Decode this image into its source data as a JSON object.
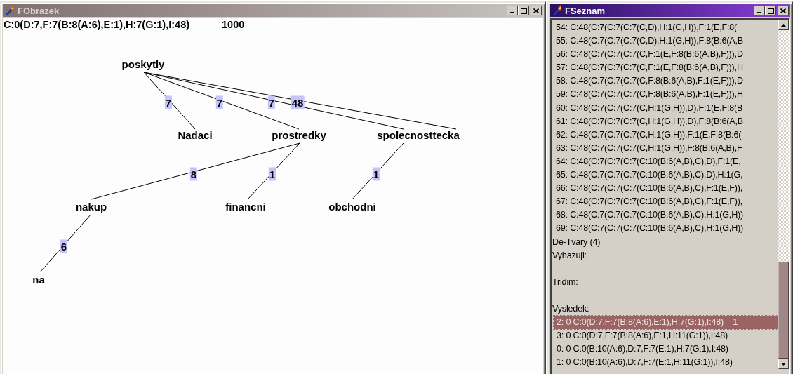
{
  "windows": [
    {
      "kind": "tree",
      "title": "FObrazek",
      "active": false,
      "summary": "C:0(D:7,F:7(B:8(A:6),E:1),H:7(G:1),I:48)",
      "score": "1000",
      "tree": {
        "word": "poskytly",
        "children": [
          {
            "word": "Nadaci",
            "weights": [
              "7"
            ]
          },
          {
            "word": "prostredky",
            "weights": [
              "7"
            ],
            "children": [
              {
                "word": "nakup",
                "weights": [
                  "8"
                ],
                "children": [
                  {
                    "word": "na",
                    "weights": [
                      "6"
                    ]
                  }
                ]
              },
              {
                "word": "financni",
                "weights": [
                  "1"
                ]
              }
            ]
          },
          {
            "word": "spolecnosttecka",
            "weights": [
              "7",
              "48"
            ],
            "children": [
              {
                "word": "obchodni",
                "weights": [
                  "1"
                ]
              }
            ]
          }
        ]
      }
    },
    {
      "kind": "list",
      "title": "FSeznam",
      "active": true,
      "lines": [
        {
          "kind": "entry",
          "text": "54: C:48(C:7(C:7(C:7(C,D),H:1(G,H)),F:1(E,F:8(",
          "selected": false
        },
        {
          "kind": "entry",
          "text": "55: C:48(C:7(C:7(C:7(C,D),H:1(G,H)),F:8(B:6(A,B",
          "selected": false
        },
        {
          "kind": "entry",
          "text": "56: C:48(C:7(C:7(C:7(C,F:1(E,F:8(B:6(A,B),F))),D",
          "selected": false
        },
        {
          "kind": "entry",
          "text": "57: C:48(C:7(C:7(C:7(C,F:1(E,F:8(B:6(A,B),F))),H",
          "selected": false
        },
        {
          "kind": "entry",
          "text": "58: C:48(C:7(C:7(C:7(C,F:8(B:6(A,B),F:1(E,F))),D",
          "selected": false
        },
        {
          "kind": "entry",
          "text": "59: C:48(C:7(C:7(C:7(C,F:8(B:6(A,B),F:1(E,F))),H",
          "selected": false
        },
        {
          "kind": "entry",
          "text": "60: C:48(C:7(C:7(C:7(C,H:1(G,H)),D),F:1(E,F:8(B",
          "selected": false
        },
        {
          "kind": "entry",
          "text": "61: C:48(C:7(C:7(C:7(C,H:1(G,H)),D),F:8(B:6(A,B",
          "selected": false
        },
        {
          "kind": "entry",
          "text": "62: C:48(C:7(C:7(C:7(C,H:1(G,H)),F:1(E,F:8(B:6(",
          "selected": false
        },
        {
          "kind": "entry",
          "text": "63: C:48(C:7(C:7(C:7(C,H:1(G,H)),F:8(B:6(A,B),F",
          "selected": false
        },
        {
          "kind": "entry",
          "text": "64: C:48(C:7(C:7(C:7(C:10(B:6(A,B),C),D),F:1(E,",
          "selected": false
        },
        {
          "kind": "entry",
          "text": "65: C:48(C:7(C:7(C:7(C:10(B:6(A,B),C),D),H:1(G,",
          "selected": false
        },
        {
          "kind": "entry",
          "text": "66: C:48(C:7(C:7(C:7(C:10(B:6(A,B),C),F:1(E,F)),",
          "selected": false
        },
        {
          "kind": "entry",
          "text": "67: C:48(C:7(C:7(C:7(C:10(B:6(A,B),C),F:1(E,F)),",
          "selected": false
        },
        {
          "kind": "entry",
          "text": "68: C:48(C:7(C:7(C:7(C:10(B:6(A,B),C),H:1(G,H))",
          "selected": false
        },
        {
          "kind": "entry",
          "text": "69: C:48(C:7(C:7(C:7(C:10(B:6(A,B),C),H:1(G,H))",
          "selected": false
        },
        {
          "kind": "heading",
          "text": "De-Tvary (4)"
        },
        {
          "kind": "heading",
          "text": "Vyhazuji:"
        },
        {
          "kind": "gap"
        },
        {
          "kind": "heading",
          "text": "Tridim:"
        },
        {
          "kind": "gap"
        },
        {
          "kind": "heading",
          "text": "Vysledek:"
        },
        {
          "kind": "result",
          "text": "2: 0 C:0(D:7,F:7(B:8(A:6),E:1),H:7(G:1),I:48)    1",
          "selected": true
        },
        {
          "kind": "result",
          "text": "3: 0 C:0(D:7,F:7(B:8(A:6),E:1,H:11(G:1)),I:48)",
          "selected": false
        },
        {
          "kind": "result",
          "text": "0: 0 C:0(B:10(A:6),D:7,F:7(E:1),H:7(G:1),I:48)",
          "selected": false
        },
        {
          "kind": "result",
          "text": "1: 0 C:0(B:10(A:6),D:7,F:7(E:1,H:11(G:1)),I:48)",
          "selected": false
        }
      ]
    }
  ]
}
